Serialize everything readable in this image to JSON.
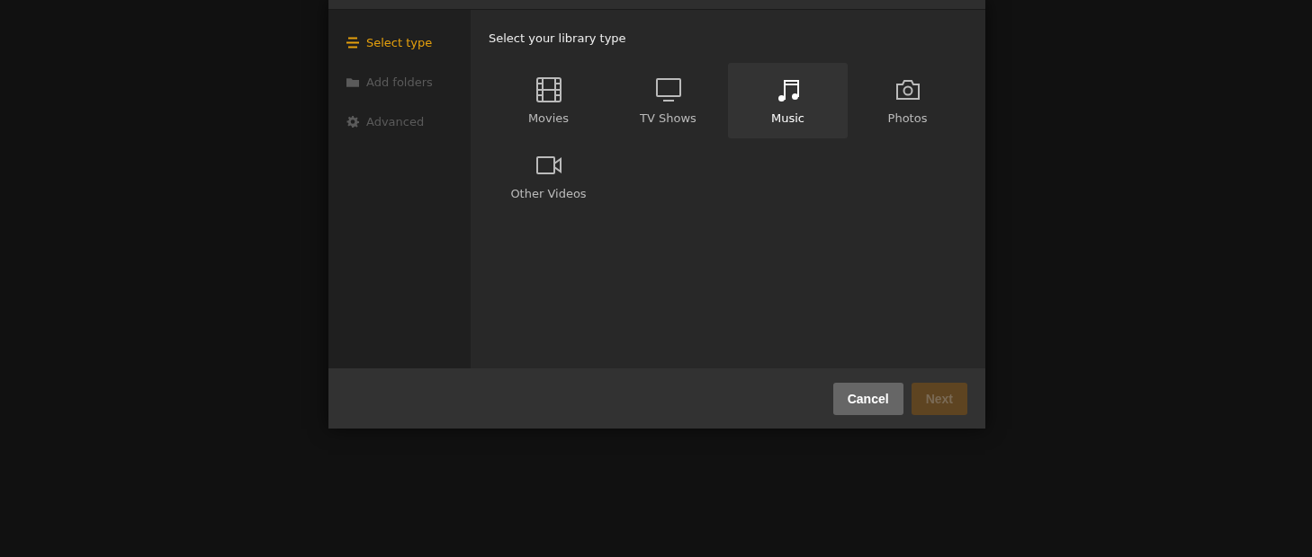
{
  "steps": [
    {
      "label": "Select type",
      "kind": "type",
      "selected": true,
      "disabled": false
    },
    {
      "label": "Add folders",
      "kind": "folders",
      "selected": false,
      "disabled": true
    },
    {
      "label": "Advanced",
      "kind": "advanced",
      "selected": false,
      "disabled": true
    }
  ],
  "heading": "Select your library type",
  "library_types": [
    {
      "label": "Movies",
      "kind": "movies",
      "highlighted": false
    },
    {
      "label": "TV Shows",
      "kind": "tv",
      "highlighted": false
    },
    {
      "label": "Music",
      "kind": "music",
      "highlighted": true
    },
    {
      "label": "Photos",
      "kind": "photos",
      "highlighted": false
    },
    {
      "label": "Other Videos",
      "kind": "videos",
      "highlighted": false
    }
  ],
  "buttons": [
    {
      "label": "Cancel",
      "kind": "cancel",
      "disabled": false
    },
    {
      "label": "Next",
      "kind": "next",
      "disabled": true
    }
  ]
}
